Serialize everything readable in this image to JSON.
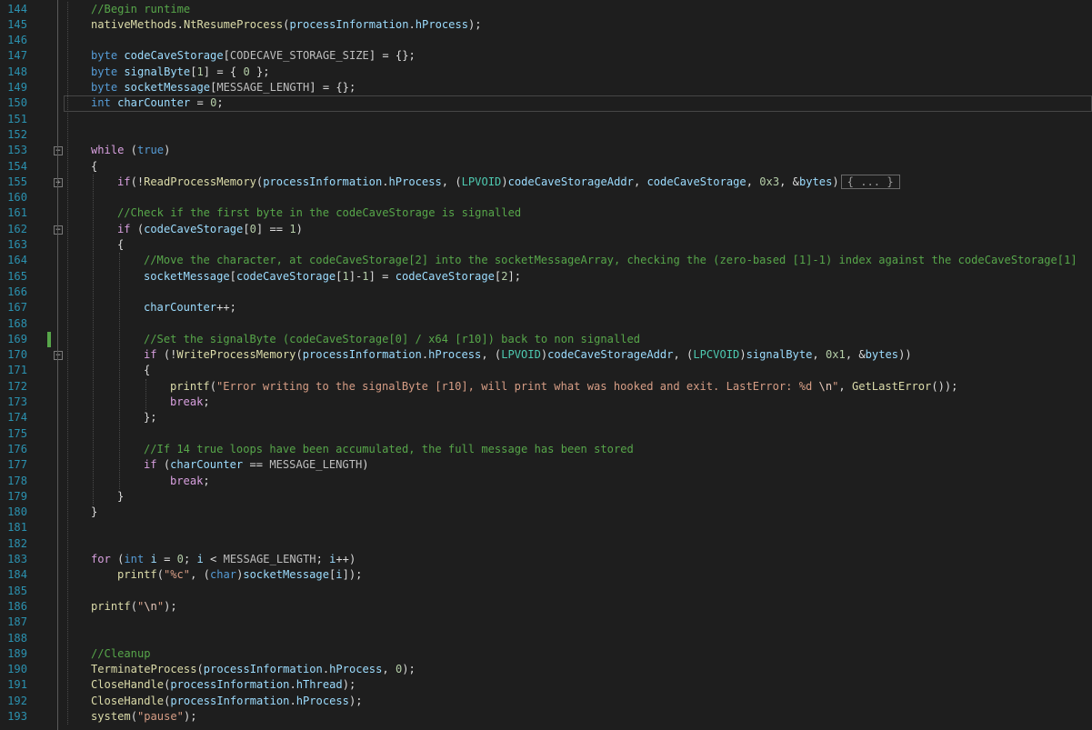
{
  "editor": {
    "colors": {
      "background": "#1e1e1e",
      "line_number": "#2b91af",
      "keyword": "#569cd6",
      "control": "#d8a0df",
      "comment": "#57a64a",
      "string": "#d69d85",
      "function": "#dcdcaa",
      "type": "#4ec9b0",
      "variable": "#9cdcfe",
      "macro": "#bebebe",
      "number": "#b5cea8"
    },
    "current_line": "150",
    "collapsed_marker": "{ ... }",
    "lines": [
      {
        "n": "144",
        "indent": 0,
        "t": [
          [
            "cm",
            "//Begin runtime"
          ]
        ]
      },
      {
        "n": "145",
        "indent": 0,
        "t": [
          [
            "fn",
            "nativeMethods"
          ],
          [
            "pl",
            "."
          ],
          [
            "fn",
            "NtResumeProcess"
          ],
          [
            "pl",
            "("
          ],
          [
            "var",
            "processInformation"
          ],
          [
            "pl",
            "."
          ],
          [
            "var",
            "hProcess"
          ],
          [
            "pl",
            ");"
          ]
        ]
      },
      {
        "n": "146",
        "indent": 0,
        "t": []
      },
      {
        "n": "147",
        "indent": 0,
        "t": [
          [
            "kw",
            "byte"
          ],
          [
            "pl",
            " "
          ],
          [
            "var",
            "codeCaveStorage"
          ],
          [
            "pl",
            "["
          ],
          [
            "mac",
            "CODECAVE_STORAGE_SIZE"
          ],
          [
            "pl",
            "] = {};"
          ]
        ]
      },
      {
        "n": "148",
        "indent": 0,
        "t": [
          [
            "kw",
            "byte"
          ],
          [
            "pl",
            " "
          ],
          [
            "var",
            "signalByte"
          ],
          [
            "pl",
            "["
          ],
          [
            "num",
            "1"
          ],
          [
            "pl",
            "] = { "
          ],
          [
            "num",
            "0"
          ],
          [
            "pl",
            " };"
          ]
        ]
      },
      {
        "n": "149",
        "indent": 0,
        "t": [
          [
            "kw",
            "byte"
          ],
          [
            "pl",
            " "
          ],
          [
            "var",
            "socketMessage"
          ],
          [
            "pl",
            "["
          ],
          [
            "mac",
            "MESSAGE_LENGTH"
          ],
          [
            "pl",
            "] = {};"
          ]
        ]
      },
      {
        "n": "150",
        "indent": 0,
        "t": [
          [
            "kw",
            "int"
          ],
          [
            "pl",
            " "
          ],
          [
            "var",
            "charCounter"
          ],
          [
            "pl",
            " = "
          ],
          [
            "num",
            "0"
          ],
          [
            "pl",
            ";"
          ]
        ]
      },
      {
        "n": "151",
        "indent": 0,
        "t": []
      },
      {
        "n": "152",
        "indent": 0,
        "t": []
      },
      {
        "n": "153",
        "indent": 0,
        "t": [
          [
            "ctl",
            "while"
          ],
          [
            "pl",
            " ("
          ],
          [
            "kw",
            "true"
          ],
          [
            "pl",
            ")"
          ]
        ]
      },
      {
        "n": "154",
        "indent": 0,
        "t": [
          [
            "pl",
            "{"
          ]
        ]
      },
      {
        "n": "155",
        "indent": 1,
        "t": [
          [
            "ctl",
            "if"
          ],
          [
            "pl",
            "(!"
          ],
          [
            "fn",
            "ReadProcessMemory"
          ],
          [
            "pl",
            "("
          ],
          [
            "var",
            "processInformation"
          ],
          [
            "pl",
            "."
          ],
          [
            "var",
            "hProcess"
          ],
          [
            "pl",
            ", ("
          ],
          [
            "ty",
            "LPVOID"
          ],
          [
            "pl",
            ")"
          ],
          [
            "var",
            "codeCaveStorageAddr"
          ],
          [
            "pl",
            ", "
          ],
          [
            "var",
            "codeCaveStorage"
          ],
          [
            "pl",
            ", "
          ],
          [
            "num",
            "0x3"
          ],
          [
            "pl",
            ", &"
          ],
          [
            "var",
            "bytes"
          ],
          [
            "pl",
            ")"
          ]
        ],
        "collapsed": true
      },
      {
        "n": "160",
        "indent": 0,
        "t": []
      },
      {
        "n": "161",
        "indent": 1,
        "t": [
          [
            "cm",
            "//Check if the first byte in the codeCaveStorage is signalled"
          ]
        ]
      },
      {
        "n": "162",
        "indent": 1,
        "t": [
          [
            "ctl",
            "if"
          ],
          [
            "pl",
            " ("
          ],
          [
            "var",
            "codeCaveStorage"
          ],
          [
            "pl",
            "["
          ],
          [
            "num",
            "0"
          ],
          [
            "pl",
            "] == "
          ],
          [
            "num",
            "1"
          ],
          [
            "pl",
            ")"
          ]
        ]
      },
      {
        "n": "163",
        "indent": 1,
        "t": [
          [
            "pl",
            "{"
          ]
        ]
      },
      {
        "n": "164",
        "indent": 2,
        "t": [
          [
            "cm",
            "//Move the character, at codeCaveStorage[2] into the socketMessageArray, checking the (zero-based [1]-1) index against the codeCaveStorage[1]"
          ]
        ]
      },
      {
        "n": "165",
        "indent": 2,
        "t": [
          [
            "var",
            "socketMessage"
          ],
          [
            "pl",
            "["
          ],
          [
            "var",
            "codeCaveStorage"
          ],
          [
            "pl",
            "["
          ],
          [
            "num",
            "1"
          ],
          [
            "pl",
            "]-"
          ],
          [
            "num",
            "1"
          ],
          [
            "pl",
            "] = "
          ],
          [
            "var",
            "codeCaveStorage"
          ],
          [
            "pl",
            "["
          ],
          [
            "num",
            "2"
          ],
          [
            "pl",
            "];"
          ]
        ]
      },
      {
        "n": "166",
        "indent": 0,
        "t": []
      },
      {
        "n": "167",
        "indent": 2,
        "t": [
          [
            "var",
            "charCounter"
          ],
          [
            "pl",
            "++;"
          ]
        ]
      },
      {
        "n": "168",
        "indent": 0,
        "t": []
      },
      {
        "n": "169",
        "indent": 2,
        "t": [
          [
            "cm",
            "//Set the signalByte (codeCaveStorage[0] / x64 [r10]) back to non signalled"
          ]
        ]
      },
      {
        "n": "170",
        "indent": 2,
        "t": [
          [
            "ctl",
            "if"
          ],
          [
            "pl",
            " (!"
          ],
          [
            "fn",
            "WriteProcessMemory"
          ],
          [
            "pl",
            "("
          ],
          [
            "var",
            "processInformation"
          ],
          [
            "pl",
            "."
          ],
          [
            "var",
            "hProcess"
          ],
          [
            "pl",
            ", ("
          ],
          [
            "ty",
            "LPVOID"
          ],
          [
            "pl",
            ")"
          ],
          [
            "var",
            "codeCaveStorageAddr"
          ],
          [
            "pl",
            ", ("
          ],
          [
            "ty",
            "LPCVOID"
          ],
          [
            "pl",
            ")"
          ],
          [
            "var",
            "signalByte"
          ],
          [
            "pl",
            ", "
          ],
          [
            "num",
            "0x1"
          ],
          [
            "pl",
            ", &"
          ],
          [
            "var",
            "bytes"
          ],
          [
            "pl",
            "))"
          ]
        ]
      },
      {
        "n": "171",
        "indent": 2,
        "t": [
          [
            "pl",
            "{"
          ]
        ]
      },
      {
        "n": "172",
        "indent": 3,
        "t": [
          [
            "fn",
            "printf"
          ],
          [
            "pl",
            "("
          ],
          [
            "st",
            "\"Error writing to the signalByte [r10], will print what was hooked and exit. LastError: %d "
          ],
          [
            "esc",
            "\\n"
          ],
          [
            "st",
            "\""
          ],
          [
            "pl",
            ", "
          ],
          [
            "fn",
            "GetLastError"
          ],
          [
            "pl",
            "());"
          ]
        ]
      },
      {
        "n": "173",
        "indent": 3,
        "t": [
          [
            "ctl",
            "break"
          ],
          [
            "pl",
            ";"
          ]
        ]
      },
      {
        "n": "174",
        "indent": 2,
        "t": [
          [
            "pl",
            "};"
          ]
        ]
      },
      {
        "n": "175",
        "indent": 0,
        "t": []
      },
      {
        "n": "176",
        "indent": 2,
        "t": [
          [
            "cm",
            "//If 14 true loops have been accumulated, the full message has been stored"
          ]
        ]
      },
      {
        "n": "177",
        "indent": 2,
        "t": [
          [
            "ctl",
            "if"
          ],
          [
            "pl",
            " ("
          ],
          [
            "var",
            "charCounter"
          ],
          [
            "pl",
            " == "
          ],
          [
            "mac",
            "MESSAGE_LENGTH"
          ],
          [
            "pl",
            ")"
          ]
        ]
      },
      {
        "n": "178",
        "indent": 3,
        "t": [
          [
            "ctl",
            "break"
          ],
          [
            "pl",
            ";"
          ]
        ]
      },
      {
        "n": "179",
        "indent": 1,
        "t": [
          [
            "pl",
            "}"
          ]
        ]
      },
      {
        "n": "180",
        "indent": 0,
        "t": [
          [
            "pl",
            "}"
          ]
        ]
      },
      {
        "n": "181",
        "indent": 0,
        "t": []
      },
      {
        "n": "182",
        "indent": 0,
        "t": []
      },
      {
        "n": "183",
        "indent": 0,
        "t": [
          [
            "ctl",
            "for"
          ],
          [
            "pl",
            " ("
          ],
          [
            "kw",
            "int"
          ],
          [
            "pl",
            " "
          ],
          [
            "var",
            "i"
          ],
          [
            "pl",
            " = "
          ],
          [
            "num",
            "0"
          ],
          [
            "pl",
            "; "
          ],
          [
            "var",
            "i"
          ],
          [
            "pl",
            " < "
          ],
          [
            "mac",
            "MESSAGE_LENGTH"
          ],
          [
            "pl",
            "; "
          ],
          [
            "var",
            "i"
          ],
          [
            "pl",
            "++)"
          ]
        ]
      },
      {
        "n": "184",
        "indent": 1,
        "t": [
          [
            "fn",
            "printf"
          ],
          [
            "pl",
            "("
          ],
          [
            "st",
            "\"%c\""
          ],
          [
            "pl",
            ", ("
          ],
          [
            "kw",
            "char"
          ],
          [
            "pl",
            ")"
          ],
          [
            "var",
            "socketMessage"
          ],
          [
            "pl",
            "["
          ],
          [
            "var",
            "i"
          ],
          [
            "pl",
            "]);"
          ]
        ]
      },
      {
        "n": "185",
        "indent": 0,
        "t": []
      },
      {
        "n": "186",
        "indent": 0,
        "t": [
          [
            "fn",
            "printf"
          ],
          [
            "pl",
            "("
          ],
          [
            "st",
            "\""
          ],
          [
            "esc",
            "\\n"
          ],
          [
            "st",
            "\""
          ],
          [
            "pl",
            ");"
          ]
        ]
      },
      {
        "n": "187",
        "indent": 0,
        "t": []
      },
      {
        "n": "188",
        "indent": 0,
        "t": []
      },
      {
        "n": "189",
        "indent": 0,
        "t": [
          [
            "cm",
            "//Cleanup"
          ]
        ]
      },
      {
        "n": "190",
        "indent": 0,
        "t": [
          [
            "fn",
            "TerminateProcess"
          ],
          [
            "pl",
            "("
          ],
          [
            "var",
            "processInformation"
          ],
          [
            "pl",
            "."
          ],
          [
            "var",
            "hProcess"
          ],
          [
            "pl",
            ", "
          ],
          [
            "num",
            "0"
          ],
          [
            "pl",
            ");"
          ]
        ]
      },
      {
        "n": "191",
        "indent": 0,
        "t": [
          [
            "fn",
            "CloseHandle"
          ],
          [
            "pl",
            "("
          ],
          [
            "var",
            "processInformation"
          ],
          [
            "pl",
            "."
          ],
          [
            "var",
            "hThread"
          ],
          [
            "pl",
            ");"
          ]
        ]
      },
      {
        "n": "192",
        "indent": 0,
        "t": [
          [
            "fn",
            "CloseHandle"
          ],
          [
            "pl",
            "("
          ],
          [
            "var",
            "processInformation"
          ],
          [
            "pl",
            "."
          ],
          [
            "var",
            "hProcess"
          ],
          [
            "pl",
            ");"
          ]
        ]
      },
      {
        "n": "193",
        "indent": 0,
        "t": [
          [
            "fn",
            "system"
          ],
          [
            "pl",
            "("
          ],
          [
            "st",
            "\"pause\""
          ],
          [
            "pl",
            ");"
          ]
        ]
      }
    ]
  }
}
